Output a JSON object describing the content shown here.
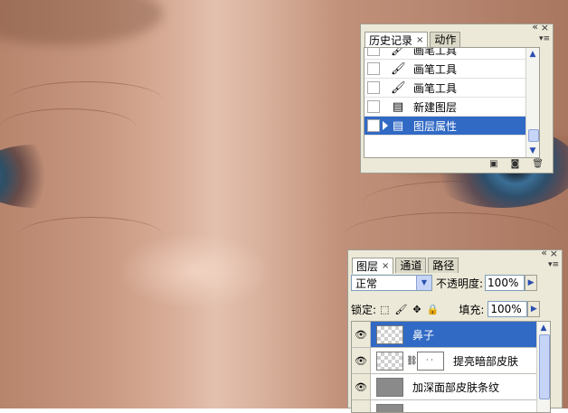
{
  "history_panel": {
    "tabs": [
      {
        "label": "历史记录",
        "active": true,
        "closable": true
      },
      {
        "label": "动作",
        "active": false,
        "closable": false
      }
    ],
    "close_glyph": "×",
    "min_glyph": "«",
    "menu_glyph": "▾≡",
    "states": [
      {
        "label": "画笔工具",
        "icon": "brush-icon",
        "glyph": "🖌",
        "selected": false
      },
      {
        "label": "画笔工具",
        "icon": "brush-icon",
        "glyph": "🖌",
        "selected": false
      },
      {
        "label": "画笔工具",
        "icon": "brush-icon",
        "glyph": "🖌",
        "selected": false
      },
      {
        "label": "新建图层",
        "icon": "new-layer-doc-icon",
        "glyph": "▤",
        "selected": false
      },
      {
        "label": "图层属性",
        "icon": "layer-properties-doc-icon",
        "glyph": "▤",
        "selected": true
      }
    ],
    "footer_icons": [
      {
        "icon": "new-document-from-state-icon",
        "glyph": "▣"
      },
      {
        "icon": "new-snapshot-icon",
        "glyph": "◙"
      },
      {
        "icon": "trash-icon",
        "glyph": "🗑"
      }
    ]
  },
  "layers_panel": {
    "tabs": [
      {
        "label": "图层",
        "active": true,
        "closable": true
      },
      {
        "label": "通道",
        "active": false,
        "closable": false
      },
      {
        "label": "路径",
        "active": false,
        "closable": false
      }
    ],
    "close_glyph": "×",
    "min_glyph": "«",
    "menu_glyph": "▾≡",
    "blend_mode": "正常",
    "opacity_label": "不透明度:",
    "opacity_value": "100%",
    "lock_label": "锁定:",
    "lock_icons": [
      {
        "icon": "lock-transparency-icon",
        "glyph": "⬚"
      },
      {
        "icon": "lock-image-brush-icon",
        "glyph": "🖌"
      },
      {
        "icon": "lock-position-icon",
        "glyph": "✥"
      },
      {
        "icon": "lock-all-icon",
        "glyph": "🔒"
      }
    ],
    "fill_label": "填充:",
    "fill_value": "100%",
    "layers": [
      {
        "name": "鼻子",
        "visible": true,
        "selected": true,
        "thumb": "transparent",
        "has_mask": false
      },
      {
        "name": "提亮暗部皮肤",
        "visible": true,
        "selected": false,
        "thumb": "transparent",
        "has_mask": true,
        "mask_dots": "· ·"
      },
      {
        "name": "加深面部皮肤条纹",
        "visible": true,
        "selected": false,
        "thumb": "grey",
        "has_mask": false
      }
    ],
    "eye_glyph": "👁",
    "link_glyph": "⛓"
  },
  "colors": {
    "selection": "#316ac5",
    "panel_bg": "#ece9d8"
  }
}
